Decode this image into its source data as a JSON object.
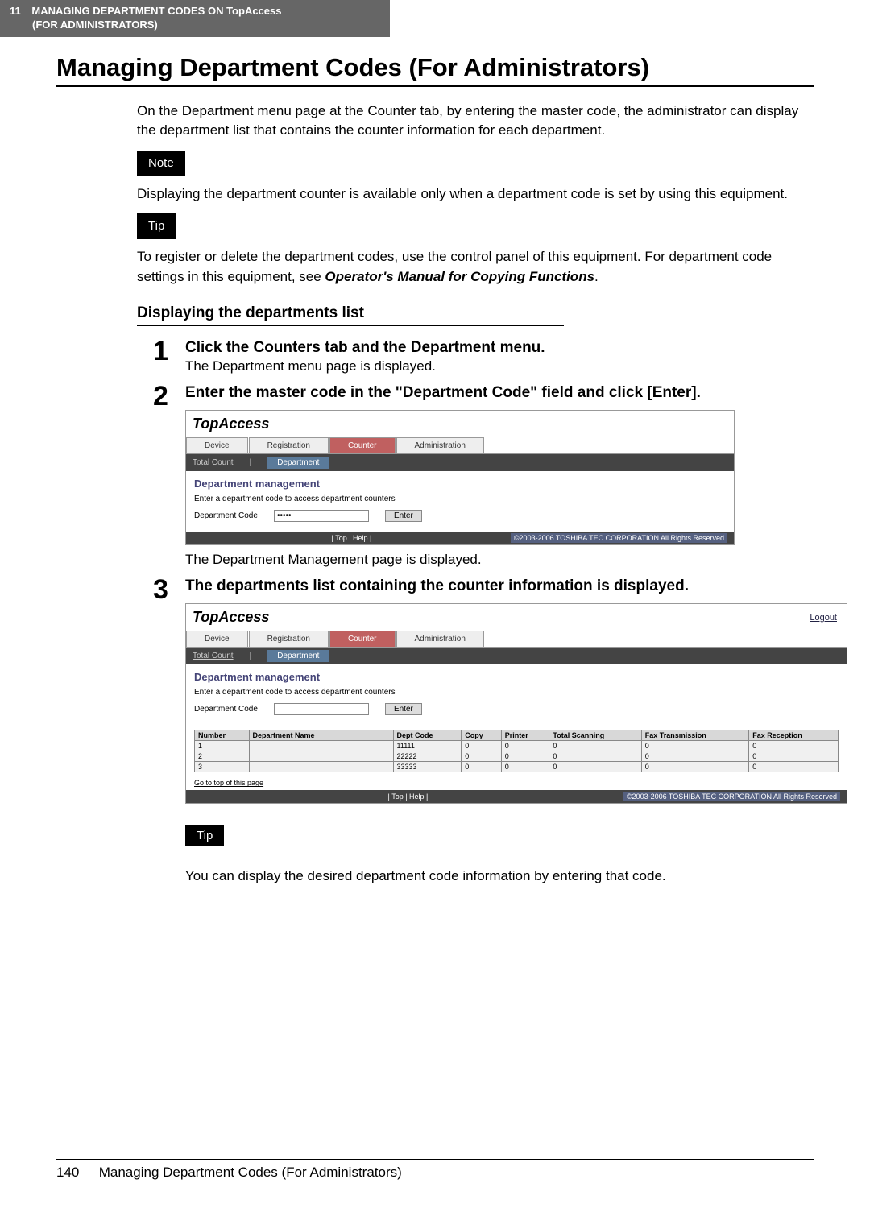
{
  "header": {
    "chapter_num": "11",
    "chapter_title": "MANAGING DEPARTMENT CODES ON TopAccess",
    "chapter_sub": "(FOR ADMINISTRATORS)"
  },
  "title": "Managing Department Codes (For Administrators)",
  "intro": "On the Department menu page at the Counter tab, by entering the master code, the administrator can display the department list that contains the counter information for each department.",
  "note_label": "Note",
  "note_text": "Displaying the department counter is available only when a department code is set by using this equipment.",
  "tip_label": "Tip",
  "tip_text_1": "To register or delete the department codes, use the control panel of this equipment. For department code settings in this equipment, see ",
  "tip_text_1_bold": "Operator's Manual for Copying Functions",
  "tip_text_1_end": ".",
  "section_title": "Displaying the departments list",
  "steps": [
    {
      "num": "1",
      "title": "Click the Counters tab and the Department menu.",
      "desc": "The Department menu page is displayed."
    },
    {
      "num": "2",
      "title": "Enter the master code in the \"Department Code\" field and click [Enter].",
      "desc_after": "The Department Management page is displayed."
    },
    {
      "num": "3",
      "title": "The departments list containing the counter information is displayed."
    }
  ],
  "ta": {
    "logo": "TopAccess",
    "logout": "Logout",
    "tabs": [
      "Device",
      "Registration",
      "Counter",
      "Administration"
    ],
    "subtabs": {
      "total_count": "Total Count",
      "department": "Department",
      "sep": "|"
    },
    "heading": "Department management",
    "instruction": "Enter a department code to access department counters",
    "field_label": "Department Code",
    "masked_value": "•••••",
    "enter_btn": "Enter",
    "footer_links": "| Top | Help |",
    "copyright": "©2003-2006 TOSHIBA TEC CORPORATION All Rights Reserved",
    "gotop": "Go to top of this page",
    "table": {
      "headers": [
        "Number",
        "Department Name",
        "Dept Code",
        "Copy",
        "Printer",
        "Total Scanning",
        "Fax Transmission",
        "Fax Reception"
      ],
      "rows": [
        [
          "1",
          "",
          "11111",
          "0",
          "0",
          "0",
          "0",
          "0"
        ],
        [
          "2",
          "",
          "22222",
          "0",
          "0",
          "0",
          "0",
          "0"
        ],
        [
          "3",
          "",
          "33333",
          "0",
          "0",
          "0",
          "0",
          "0"
        ]
      ]
    }
  },
  "tip_text_2": "You can display the desired department code information by entering that code.",
  "footer": {
    "page_num": "140",
    "page_title": "Managing Department Codes (For Administrators)"
  }
}
